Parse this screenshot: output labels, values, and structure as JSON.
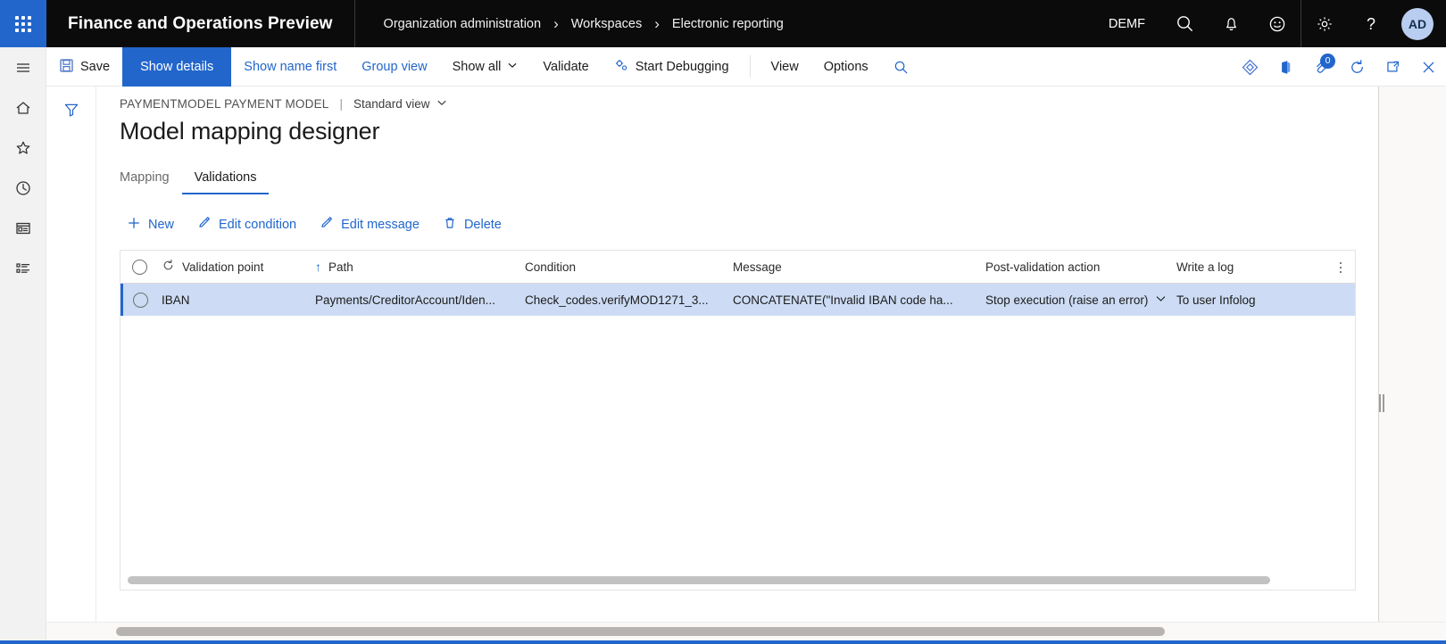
{
  "topbar": {
    "waffle_icon": "app-launcher-icon",
    "app_title": "Finance and Operations Preview",
    "breadcrumb": [
      {
        "label": "Organization administration"
      },
      {
        "label": "Workspaces"
      },
      {
        "label": "Electronic reporting"
      }
    ],
    "separator": "›",
    "company": "DEMF",
    "icons": [
      {
        "name": "search-icon"
      },
      {
        "name": "notifications-bell-icon"
      },
      {
        "name": "feedback-smiley-icon"
      },
      {
        "name": "settings-gear-icon"
      },
      {
        "name": "help-question-icon"
      }
    ],
    "avatar_initials": "AD"
  },
  "rail": {
    "items": [
      {
        "name": "hamburger-menu-icon",
        "label": "Expand the navigation pane"
      },
      {
        "name": "home-icon",
        "label": "Home"
      },
      {
        "name": "favorites-star-icon",
        "label": "Favorites"
      },
      {
        "name": "recent-clock-icon",
        "label": "Recent"
      },
      {
        "name": "workspaces-icon",
        "label": "Workspaces"
      },
      {
        "name": "modules-list-icon",
        "label": "Modules"
      }
    ]
  },
  "commandbar": {
    "save_label": "Save",
    "buttons": [
      {
        "label": "Show details",
        "state": "active"
      },
      {
        "label": "Show name first",
        "state": "link"
      },
      {
        "label": "Group view",
        "state": "link"
      },
      {
        "label": "Show all",
        "state": "link",
        "caret": "⌄"
      },
      {
        "label": "Validate",
        "state": "link"
      },
      {
        "label": "Start Debugging",
        "state": "link",
        "icon": "debug-gears-icon"
      },
      {
        "label": "View",
        "state": "dark"
      },
      {
        "label": "Options",
        "state": "dark"
      }
    ],
    "search_icon": "search-icon",
    "right_icons": [
      {
        "name": "power-apps-diamond-icon"
      },
      {
        "name": "open-in-office-icon"
      },
      {
        "name": "attachments-icon",
        "badge": "0"
      },
      {
        "name": "refresh-icon"
      },
      {
        "name": "popout-window-icon"
      },
      {
        "name": "close-icon"
      }
    ]
  },
  "filterpane": {
    "filter_icon": "filter-funnel-icon"
  },
  "page": {
    "caption": "PAYMENTMODEL PAYMENT MODEL",
    "caption_divider": "|",
    "view_selector": "Standard view",
    "view_caret": "⌄",
    "title": "Model mapping designer",
    "tabs": [
      {
        "label": "Mapping",
        "selected": false
      },
      {
        "label": "Validations",
        "selected": true
      }
    ]
  },
  "grid_toolbar": {
    "buttons": [
      {
        "label": "New",
        "icon": "plus-icon"
      },
      {
        "label": "Edit condition",
        "icon": "pencil-icon"
      },
      {
        "label": "Edit message",
        "icon": "pencil-icon"
      },
      {
        "label": "Delete",
        "icon": "trash-icon"
      }
    ]
  },
  "grid": {
    "columns": [
      {
        "label": "Validation point",
        "sort": "",
        "icon": "refresh-small-icon"
      },
      {
        "label": "Path",
        "sort": "↑"
      },
      {
        "label": "Condition",
        "sort": ""
      },
      {
        "label": "Message",
        "sort": ""
      },
      {
        "label": "Post-validation action",
        "sort": ""
      },
      {
        "label": "Write a log",
        "sort": ""
      }
    ],
    "column_options_icon": "column-options-icon",
    "rows": [
      {
        "selected": true,
        "validation_point": "IBAN",
        "path": "Payments/CreditorAccount/Iden...",
        "condition": "Check_codes.verifyMOD1271_3...",
        "message": "CONCATENATE(\"Invalid IBAN code ha...",
        "post_validation_action": "Stop execution (raise an error)",
        "post_validation_caret": "⌄",
        "write_a_log": "To user Infolog"
      }
    ]
  },
  "colors": {
    "brand_blue": "#2266cc",
    "topbar_black": "#0b0b0b",
    "row_selected": "#cddcf4",
    "rail_bg": "#f2f2f2"
  }
}
